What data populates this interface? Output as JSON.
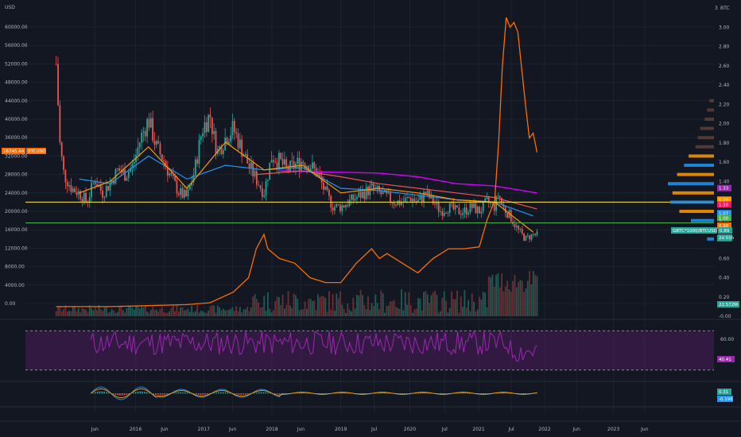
{
  "header": {
    "left_currency": "USD",
    "right_currency": "BTC"
  },
  "price_overlay": {
    "value": "16745.4A",
    "label": "BTCUSD"
  },
  "left_axis": {
    "min": 0,
    "max": 60000,
    "ticks": [
      "60000.00",
      "56000.00",
      "52000.00",
      "48000.00",
      "44000.00",
      "40000.00",
      "36000.00",
      "32000.00",
      "28000.00",
      "24000.00",
      "20000.00",
      "16000.00",
      "12000.00",
      "8000.00",
      "4000.00",
      "0.00"
    ]
  },
  "right_axis": {
    "min": 0,
    "max": 3.2,
    "ticks": [
      "3.00",
      "2.80",
      "2.60",
      "2.40",
      "2.20",
      "2.00",
      "1.80",
      "1.60",
      "1.40",
      "1.20",
      "1.00",
      "0.80",
      "0.60",
      "0.40",
      "0.20",
      "-0.00"
    ],
    "top_label": "3"
  },
  "right_tags": [
    {
      "text": "1.33",
      "color": "#9c27b0",
      "value": 1.33
    },
    {
      "text": "1.20",
      "color": "#ff9800",
      "value": 1.21
    },
    {
      "text": "1.16",
      "color": "#e91e63",
      "value": 1.16
    },
    {
      "text": "1.07",
      "color": "#2196f3",
      "value": 1.07
    },
    {
      "text": "1.00",
      "color": "#4caf50",
      "value": 1.02
    },
    {
      "text": "0.98",
      "color": "#ff6f00",
      "value": 0.94
    },
    {
      "text": "0.80",
      "color": "#26a69a",
      "value": 0.81
    }
  ],
  "ratio_badge": {
    "symbol": "GBTC*1000/BTCUSD",
    "value": "0.89",
    "sub": "2d 01h"
  },
  "volume_badge": "22.572M",
  "rsi": {
    "ticks": [
      "60.00"
    ],
    "value": "40.41"
  },
  "macd": {
    "value": "0.31",
    "value2": "-0.196"
  },
  "x_axis": {
    "labels": [
      {
        "text": "Jun",
        "pos": 0.128
      },
      {
        "text": "2016",
        "pos": 0.183
      },
      {
        "text": "Jun",
        "pos": 0.222
      },
      {
        "text": "2017",
        "pos": 0.275
      },
      {
        "text": "Jun",
        "pos": 0.314
      },
      {
        "text": "2018",
        "pos": 0.367
      },
      {
        "text": "Jun",
        "pos": 0.406
      },
      {
        "text": "2019",
        "pos": 0.46
      },
      {
        "text": "Jul",
        "pos": 0.505
      },
      {
        "text": "2020",
        "pos": 0.553
      },
      {
        "text": "Jul",
        "pos": 0.6
      },
      {
        "text": "2021",
        "pos": 0.646
      },
      {
        "text": "Jul",
        "pos": 0.69
      },
      {
        "text": "2022",
        "pos": 0.735
      },
      {
        "text": "Jun",
        "pos": 0.778
      },
      {
        "text": "2023",
        "pos": 0.828
      },
      {
        "text": "Jun",
        "pos": 0.87
      }
    ]
  },
  "chart_data": {
    "type": "line",
    "x_unit": "years",
    "price_series": {
      "name": "BTCUSD",
      "x": [
        2015.3,
        2015.35,
        2015.4,
        2015.5,
        2015.6,
        2015.7,
        2015.8,
        2015.9,
        2016.0,
        2016.1,
        2016.2,
        2016.3,
        2016.4,
        2016.5,
        2016.6,
        2016.7,
        2016.8,
        2016.9,
        2017.0,
        2017.1,
        2017.2,
        2017.3,
        2017.35,
        2017.4,
        2017.5,
        2017.6,
        2017.7,
        2017.8,
        2017.9,
        2018.0,
        2018.1,
        2018.2,
        2018.3,
        2018.4,
        2018.5,
        2018.6,
        2018.7,
        2018.8,
        2018.9,
        2019.0,
        2019.1,
        2019.2,
        2019.3,
        2019.4,
        2019.5,
        2019.6,
        2019.7,
        2019.8,
        2019.9,
        2020.0,
        2020.1,
        2020.2,
        2020.3,
        2020.4,
        2020.5,
        2020.6,
        2020.7,
        2020.8,
        2020.9,
        2021.0,
        2021.05,
        2021.1,
        2021.2,
        2021.3,
        2021.4,
        2021.45,
        2021.5,
        2021.55
      ],
      "y": [
        52000,
        34000,
        28000,
        25000,
        24000,
        22000,
        27000,
        24000,
        26000,
        29000,
        28000,
        30000,
        36000,
        40000,
        34000,
        31000,
        27000,
        24000,
        23000,
        29000,
        38000,
        41000,
        36000,
        33000,
        36000,
        38000,
        34000,
        30000,
        27000,
        24000,
        32000,
        31000,
        29000,
        30000,
        31000,
        30000,
        28000,
        24000,
        21000,
        21000,
        22000,
        23000,
        24000,
        25000,
        24000,
        23000,
        22000,
        22000,
        23000,
        22000,
        24000,
        22000,
        20000,
        21000,
        20000,
        20000,
        21000,
        20000,
        22000,
        21000,
        24000,
        21000,
        19000,
        16000,
        14000,
        14500,
        15000,
        14800
      ]
    },
    "ma_orange": {
      "x": [
        2015.6,
        2016.0,
        2016.5,
        2017.0,
        2017.5,
        2018.0,
        2018.5,
        2019.0,
        2019.5,
        2020.0,
        2020.5,
        2021.0,
        2021.5
      ],
      "y": [
        24000,
        26500,
        34000,
        25000,
        35000,
        29000,
        30000,
        24000,
        25000,
        24000,
        22500,
        22000,
        15500
      ]
    },
    "ma_blue": {
      "x": [
        2015.6,
        2016.0,
        2016.5,
        2017.0,
        2017.5,
        2018.0,
        2018.5,
        2019.0,
        2019.5,
        2020.0,
        2020.5,
        2021.0,
        2021.5
      ],
      "y": [
        27000,
        26000,
        32000,
        27000,
        30000,
        29000,
        29500,
        25000,
        24500,
        23500,
        22500,
        22000,
        19000
      ]
    },
    "ma_salmon": {
      "x": [
        2017.9,
        2018.5,
        2019.0,
        2019.5,
        2020.0,
        2020.5,
        2021.0,
        2021.55
      ],
      "y": [
        28000,
        28800,
        27500,
        26000,
        25000,
        24000,
        23000,
        20500
      ]
    },
    "ma_magenta": {
      "x": [
        2018.2,
        2018.6,
        2019.0,
        2019.5,
        2020.0,
        2020.5,
        2021.0,
        2021.55
      ],
      "y": [
        28800,
        28600,
        28500,
        28300,
        27500,
        26000,
        25500,
        24000
      ]
    },
    "ratio_series": {
      "name": "GBTC*1000/BTCUSD",
      "x": [
        2015.3,
        2016.0,
        2016.5,
        2017.0,
        2017.3,
        2017.6,
        2017.8,
        2017.9,
        2018.0,
        2018.05,
        2018.2,
        2018.4,
        2018.6,
        2018.8,
        2019.0,
        2019.2,
        2019.4,
        2019.5,
        2019.6,
        2019.8,
        2020.0,
        2020.2,
        2020.4,
        2020.6,
        2020.8,
        2020.9,
        2021.0,
        2021.05,
        2021.1,
        2021.15,
        2021.2,
        2021.25,
        2021.3,
        2021.4,
        2021.45,
        2021.5,
        2021.55
      ],
      "y": [
        0.1,
        0.1,
        0.11,
        0.12,
        0.14,
        0.25,
        0.4,
        0.7,
        0.85,
        0.7,
        0.6,
        0.55,
        0.4,
        0.35,
        0.35,
        0.55,
        0.7,
        0.6,
        0.65,
        0.55,
        0.45,
        0.6,
        0.7,
        0.7,
        0.72,
        1.0,
        1.2,
        1.8,
        2.6,
        3.1,
        3.0,
        3.05,
        2.95,
        2.2,
        1.85,
        1.9,
        1.7
      ]
    },
    "levels": [
      {
        "name": "yellow-level",
        "value": 22000,
        "color": "#ffeb3b"
      },
      {
        "name": "green-level",
        "value": 17500,
        "color": "#4caf50"
      }
    ],
    "volume_profile": {
      "price_levels": [
        44000,
        42000,
        40000,
        38000,
        36000,
        34000,
        32000,
        30000,
        28000,
        26000,
        24000,
        22000,
        20000,
        18000,
        16000,
        14000
      ],
      "volumes": [
        0.1,
        0.15,
        0.2,
        0.3,
        0.35,
        0.4,
        0.55,
        0.65,
        0.8,
        1.0,
        0.9,
        0.95,
        0.75,
        0.5,
        0.3,
        0.15
      ]
    },
    "rsi_band": {
      "upper": 70,
      "lower": 30,
      "min": 20,
      "max": 80
    }
  },
  "colors": {
    "price": "#ff6d00",
    "ratio": "#ff6d00",
    "ma_orange": "#ff9800",
    "ma_blue": "#2196f3",
    "ma_salmon": "#ef5350",
    "ma_magenta": "#d500f9",
    "rsi": "#9c27b0"
  }
}
